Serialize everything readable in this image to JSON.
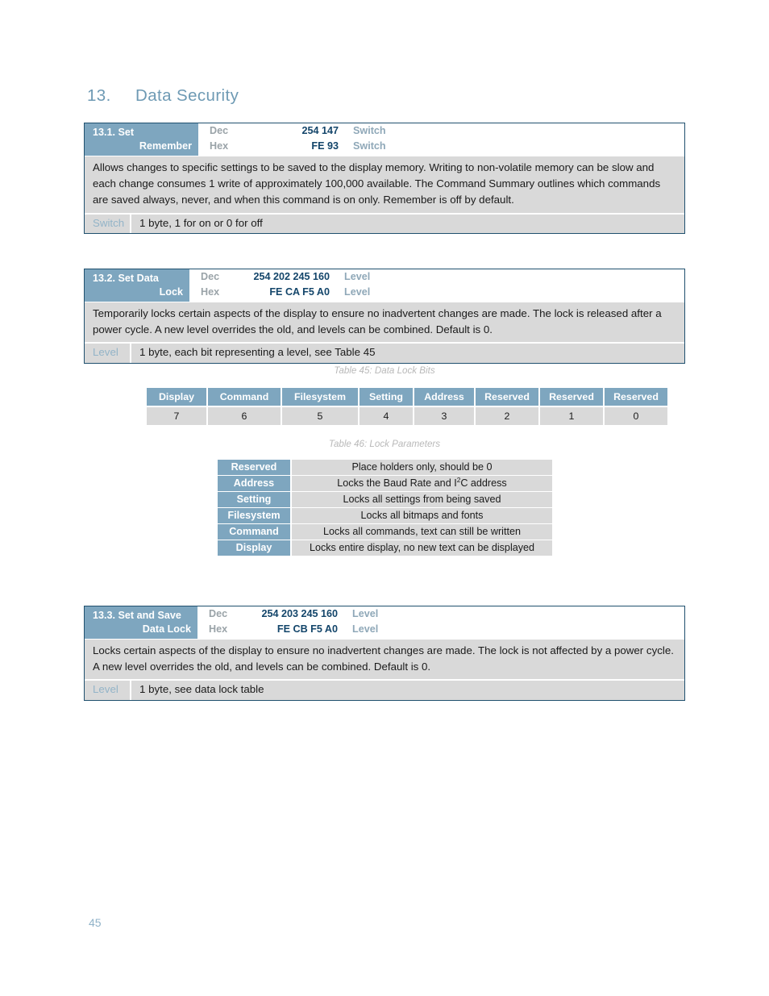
{
  "document": {
    "section_number": "13.",
    "section_title": "Data Security",
    "page_number": "45"
  },
  "commands": [
    {
      "id": "set-remember",
      "number": "13.1.",
      "name_line1": "13.1. Set",
      "name_line2": "Remember",
      "dec_label": "Dec",
      "dec_value": "254 147",
      "dec_param": "Switch",
      "hex_label": "Hex",
      "hex_value": "FE 93",
      "hex_param": "Switch",
      "description": "Allows changes to specific settings to be saved to the display memory.  Writing to non-volatile memory can be slow and each change consumes 1 write of approximately 100,000 available.  The Command Summary outlines which commands are saved always, never, and when this command is on only.  Remember is off by default.",
      "param_name": "Switch",
      "param_desc": "1 byte, 1 for on or 0 for off"
    },
    {
      "id": "set-data-lock",
      "number": "13.2.",
      "name_line1": "13.2. Set Data",
      "name_line2": "Lock",
      "dec_label": "Dec",
      "dec_value": "254 202 245 160",
      "dec_param": "Level",
      "hex_label": "Hex",
      "hex_value": "FE CA F5 A0",
      "hex_param": "Level",
      "description": "Temporarily locks certain aspects of the display to ensure no inadvertent changes are made.  The lock is released after a power cycle.  A new level overrides the old, and levels can be combined.  Default is 0.",
      "param_name": "Level",
      "param_desc": "1 byte, each bit representing a level, see Table 45"
    },
    {
      "id": "set-and-save-data-lock",
      "number": "13.3.",
      "name_line1": "13.3. Set and Save",
      "name_line2": "Data Lock",
      "dec_label": "Dec",
      "dec_value": "254 203 245 160",
      "dec_param": "Level",
      "hex_label": "Hex",
      "hex_value": "FE CB F5 A0",
      "hex_param": "Level",
      "description": "Locks certain aspects of the display to ensure no inadvertent changes are made.  The lock is not affected by a power cycle.  A new level overrides the old, and levels can be combined.  Default is 0.",
      "param_name": "Level",
      "param_desc": "1 byte, see data lock table"
    }
  ],
  "table45": {
    "caption": "Table 45: Data Lock Bits",
    "headers": [
      "Display",
      "Command",
      "Filesystem",
      "Setting",
      "Address",
      "Reserved",
      "Reserved",
      "Reserved"
    ],
    "bits": [
      "7",
      "6",
      "5",
      "4",
      "3",
      "2",
      "1",
      "0"
    ]
  },
  "table46": {
    "caption": "Table 46: Lock Parameters",
    "rows": [
      {
        "label": "Reserved",
        "description": "Place holders only, should be 0"
      },
      {
        "label": "Address",
        "description_pre": "Locks the Baud Rate and I",
        "description_sup": "2",
        "description_post": "C address"
      },
      {
        "label": "Setting",
        "description": "Locks all settings from being saved"
      },
      {
        "label": "Filesystem",
        "description": "Locks all bitmaps and fonts"
      },
      {
        "label": "Command",
        "description": "Locks all commands, text can still be written"
      },
      {
        "label": "Display",
        "description": "Locks entire display, no new text can be displayed"
      }
    ]
  },
  "colors": {
    "accent_blue": "#7ea6bf",
    "title_blue": "#6e9ab4",
    "value_navy": "#13456a",
    "row_gray": "#d9d9d9",
    "caption_gray": "#b9b9b9",
    "border_navy": "#20506e"
  }
}
